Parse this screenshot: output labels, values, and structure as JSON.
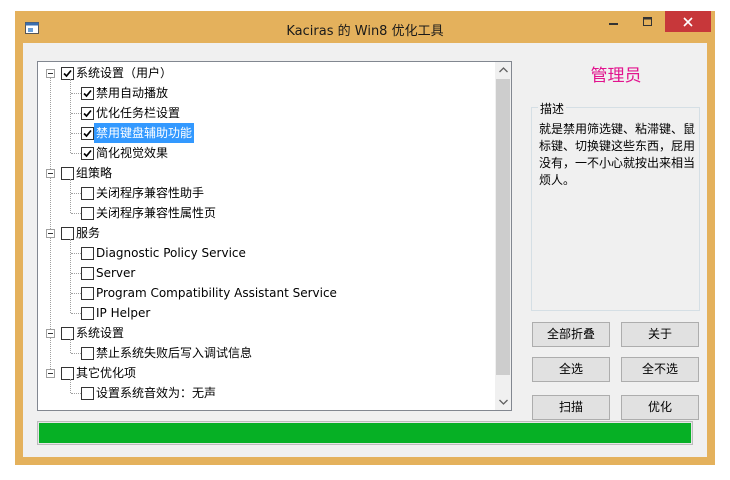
{
  "window": {
    "title": "Kaciras 的 Win8 优化工具"
  },
  "tree": {
    "groups": [
      {
        "label": "系统设置（用户）",
        "checked": true,
        "items": [
          {
            "label": "禁用自动播放",
            "checked": true
          },
          {
            "label": "优化任务栏设置",
            "checked": true
          },
          {
            "label": "禁用键盘辅助功能",
            "checked": true,
            "selected": true
          },
          {
            "label": "简化视觉效果",
            "checked": true
          }
        ]
      },
      {
        "label": "组策略",
        "checked": false,
        "items": [
          {
            "label": "关闭程序兼容性助手",
            "checked": false
          },
          {
            "label": "关闭程序兼容性属性页",
            "checked": false
          }
        ]
      },
      {
        "label": "服务",
        "checked": false,
        "items": [
          {
            "label": "Diagnostic Policy Service",
            "checked": false
          },
          {
            "label": "Server",
            "checked": false
          },
          {
            "label": "Program Compatibility Assistant Service",
            "checked": false
          },
          {
            "label": "IP Helper",
            "checked": false
          }
        ]
      },
      {
        "label": "系统设置",
        "checked": false,
        "items": [
          {
            "label": "禁止系统失败后写入调试信息",
            "checked": false
          }
        ]
      },
      {
        "label": "其它优化项",
        "checked": false,
        "items": [
          {
            "label": "设置系统音效为：无声",
            "checked": false
          }
        ]
      }
    ]
  },
  "side": {
    "admin_title": "管理员",
    "desc_legend": "描述",
    "desc_lines": [
      "就是禁用筛选键、粘滞键、鼠",
      "标键、切换键这些东西，屁用",
      "没有，一不小心就按出来相当",
      "烦人。"
    ]
  },
  "buttons": {
    "collapse_all": "全部折叠",
    "about": "关于",
    "select_all": "全选",
    "select_none": "全不选",
    "scan": "扫描",
    "optimize": "优化"
  },
  "progress": {
    "value": 1.0,
    "color": "#06b025"
  },
  "colors": {
    "accent": "#e2138e",
    "frame": "#e4b15c",
    "close": "#c7373a",
    "selection": "#3399ff"
  }
}
